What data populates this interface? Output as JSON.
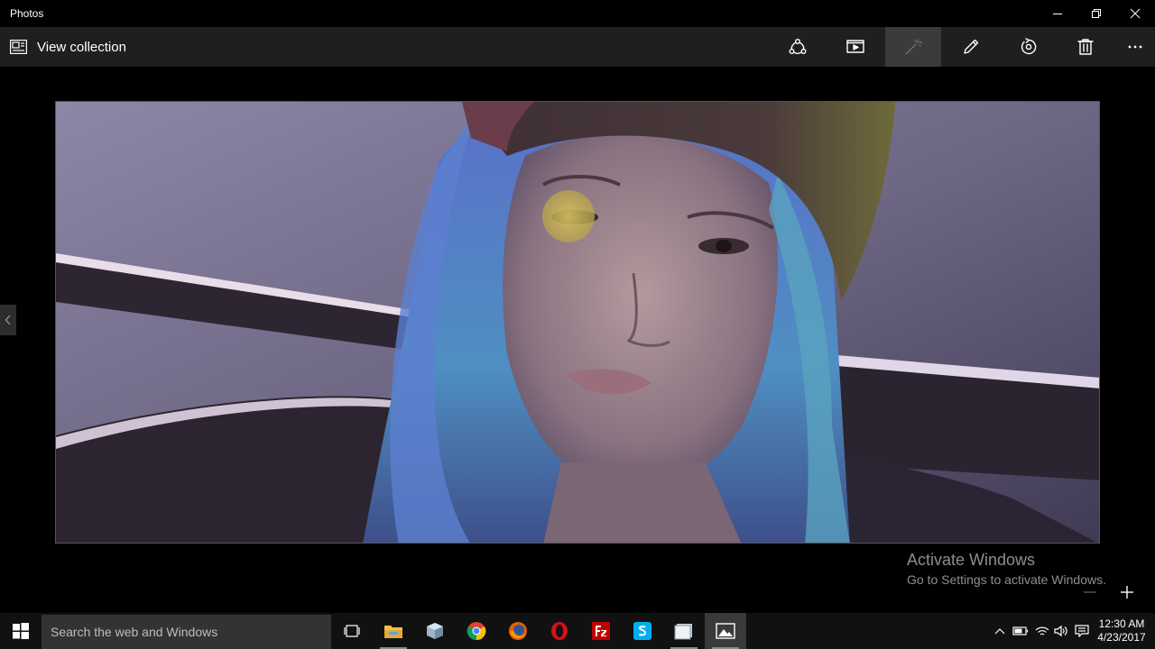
{
  "window": {
    "title": "Photos",
    "controls": [
      "minimize",
      "restore",
      "close"
    ]
  },
  "toolbar": {
    "view_collection_label": "View collection",
    "tools": [
      {
        "name": "share-icon",
        "label": "Share"
      },
      {
        "name": "slideshow-icon",
        "label": "Slideshow"
      },
      {
        "name": "enhance-icon",
        "label": "Enhance",
        "state": "active"
      },
      {
        "name": "edit-icon",
        "label": "Edit"
      },
      {
        "name": "rotate-icon",
        "label": "Rotate"
      },
      {
        "name": "delete-icon",
        "label": "Delete"
      },
      {
        "name": "more-icon",
        "label": "See more"
      }
    ]
  },
  "photo": {
    "description_icon": "photo",
    "highlight_color": "#c8b450"
  },
  "watermark": {
    "line1": "Activate Windows",
    "line2": "Go to Settings to activate Windows."
  },
  "taskbar": {
    "search_placeholder": "Search the web and Windows",
    "apps": [
      "task-view-icon",
      "file-explorer-icon",
      "box-app-icon",
      "chrome-icon",
      "firefox-icon",
      "opera-icon",
      "filezilla-icon",
      "skype-icon",
      "document-app-icon",
      "photos-app-icon"
    ],
    "clock_time": "12:30 AM",
    "clock_date": "4/23/2017"
  },
  "colors": {
    "command_bar": "#1f1f1f",
    "taskbar": "#111111",
    "search_box": "#333333",
    "opera_red": "#d60f1a",
    "filezilla_red": "#bf0000",
    "skype_blue": "#00aff0",
    "explorer_yellow": "#f3c14b"
  }
}
